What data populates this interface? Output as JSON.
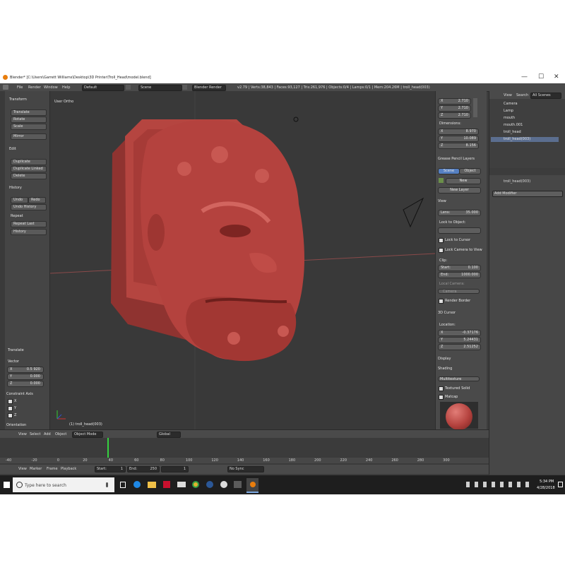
{
  "window": {
    "title": "Blender* [C:\\Users\\Garrett Williams\\Desktop\\3D Printer\\Troll_Head\\model.blend]",
    "minimize": "—",
    "maximize": "☐",
    "close": "✕"
  },
  "menu": {
    "items": [
      "File",
      "Render",
      "Window",
      "Help"
    ],
    "layout": "Default",
    "scene": "Scene",
    "engine": "Blender Render",
    "stats": "v2.79 | Verts:38,843 | Faces:93,127 | Tris:261,976 | Objects:0/4 | Lamps:0/1 | Mem:204.26M | troll_head(003)"
  },
  "toolshelf": {
    "transform_header": "Transform",
    "transform": [
      "Translate",
      "Rotate",
      "Scale",
      "Mirror"
    ],
    "edit_header": "Edit",
    "edit": [
      "Duplicate",
      "Duplicate Linked",
      "Delete"
    ],
    "history_header": "History",
    "undo": "Undo",
    "redo": "Redo",
    "undo_history": "Undo History",
    "repeat_header": "Repeat",
    "repeat_last": "Repeat Last",
    "history": "History",
    "operator_header": "Translate",
    "vector_label": "Vector",
    "vector": [
      {
        "axis": "X",
        "value": "0.5 920"
      },
      {
        "axis": "Y",
        "value": "0.000"
      },
      {
        "axis": "Z",
        "value": "0.000"
      }
    ],
    "constraint_label": "Constraint Axis",
    "constraint_axes": [
      "X",
      "Y",
      "Z"
    ],
    "orientation": "Orientation"
  },
  "viewport": {
    "view_label": "User Ortho",
    "object_label": "(1) troll_head(003)"
  },
  "properties": {
    "scale": [
      {
        "axis": "X",
        "value": "2.710"
      },
      {
        "axis": "Y",
        "value": "2.710"
      },
      {
        "axis": "Z",
        "value": "2.710"
      }
    ],
    "dimensions_label": "Dimensions:",
    "dimensions": [
      {
        "axis": "X",
        "value": "8.970"
      },
      {
        "axis": "Y",
        "value": "10.089"
      },
      {
        "axis": "Z",
        "value": "8.156"
      }
    ],
    "grease_header": "Grease Pencil Layers",
    "scene_btn": "Scene",
    "object_btn": "Object",
    "new_btn": "New",
    "new_layer_btn": "New Layer",
    "view_header": "View",
    "lens_label": "Lens:",
    "lens_value": "35.000",
    "lock_to_object": "Lock to Object:",
    "lock_to_cursor": "Lock to Cursor",
    "lock_camera": "Lock Camera to View",
    "clip_label": "Clip:",
    "clip_start_label": "Start:",
    "clip_start": "0.100",
    "clip_end_label": "End:",
    "clip_end": "1000.000",
    "local_camera": "Local Camera:",
    "camera_field": "Camera",
    "render_border": "Render Border",
    "cursor_header": "3D Cursor",
    "location_label": "Location:",
    "cursor": [
      {
        "axis": "X",
        "value": "-0.37176"
      },
      {
        "axis": "Y",
        "value": "5.24431"
      },
      {
        "axis": "Z",
        "value": "2.51252"
      }
    ],
    "display_header": "Display",
    "shading_header": "Shading",
    "shading_mode": "Multitexture",
    "textured_solid": "Textured Solid",
    "matcap": "Matcap"
  },
  "outliner": {
    "view": "View",
    "search": "Search",
    "all_scenes": "All Scenes",
    "rows": [
      "Camera",
      "Lamp",
      "mouth",
      "mouth.001",
      "troll_head",
      "troll_head(003)"
    ]
  },
  "modifiers": {
    "object_name": "troll_head(003)",
    "add_modifier": "Add Modifier"
  },
  "view3d_header": {
    "items": [
      "View",
      "Select",
      "Add",
      "Object"
    ],
    "mode": "Object Mode",
    "orientation": "Global"
  },
  "timeline": {
    "ruler": [
      "-40",
      "-20",
      "0",
      "20",
      "40",
      "60",
      "80",
      "100",
      "120",
      "140",
      "160",
      "180",
      "200",
      "220",
      "240",
      "260",
      "280",
      "300"
    ],
    "menu": [
      "View",
      "Marker",
      "Frame",
      "Playback"
    ],
    "start_label": "Start:",
    "start": "1",
    "end_label": "End:",
    "end": "250",
    "current": "1",
    "sync": "No Sync"
  },
  "taskbar": {
    "search_placeholder": "Type here to search",
    "time": "5:34 PM",
    "date": "4/28/2018"
  },
  "colors": {
    "model": "#b4423e",
    "accent_blue": "#5680c2",
    "timeline_cursor": "#35d13f"
  }
}
